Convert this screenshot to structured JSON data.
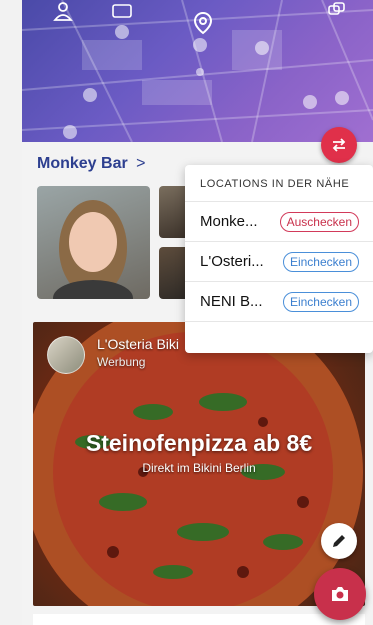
{
  "header": {
    "icons": [
      "user-icon",
      "tv-icon",
      "location-pin-icon",
      "chat-icon"
    ]
  },
  "bar": {
    "title": "Monkey Bar",
    "chevron": ">"
  },
  "nearby": {
    "header": "LOCATIONS IN DER NÄHE",
    "items": [
      {
        "name": "Monke...",
        "action": "Auschecken",
        "action_type": "checkout"
      },
      {
        "name": "L'Osteri...",
        "action": "Einchecken",
        "action_type": "checkin"
      },
      {
        "name": "NENI B...",
        "action": "Einchecken",
        "action_type": "checkin"
      }
    ]
  },
  "promo": {
    "venue": "L'Osteria Biki",
    "ad_label": "Werbung",
    "title": "Steinofenpizza ab 8€",
    "subtitle": "Direkt im Bikini Berlin"
  },
  "colors": {
    "accent": "#e0304a",
    "title_blue": "#2d3f8f",
    "checkin_blue": "#3b7fcf"
  }
}
